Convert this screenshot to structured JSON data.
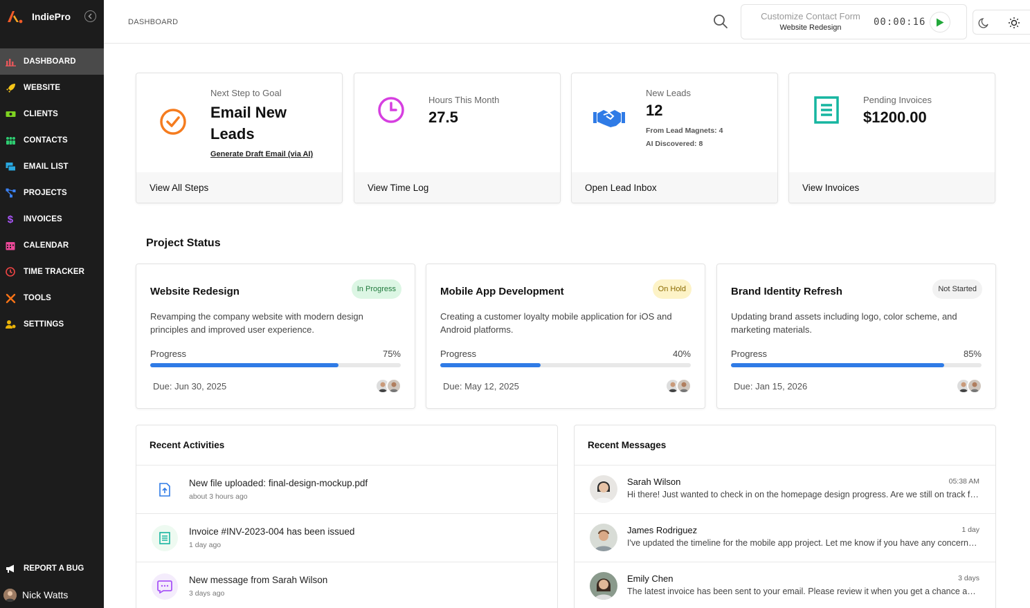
{
  "app": {
    "name": "IndiePro"
  },
  "sidebar": {
    "items": [
      {
        "label": "DASHBOARD",
        "icon": "bar-chart-icon",
        "color": "#e2575a",
        "active": true
      },
      {
        "label": "WEBSITE",
        "icon": "rocket-icon",
        "color": "#f5c518"
      },
      {
        "label": "CLIENTS",
        "icon": "cash-icon",
        "color": "#7ed321"
      },
      {
        "label": "CONTACTS",
        "icon": "people-icon",
        "color": "#2ecc71"
      },
      {
        "label": "EMAIL LIST",
        "icon": "email-list-icon",
        "color": "#29a8e0"
      },
      {
        "label": "PROJECTS",
        "icon": "project-tree-icon",
        "color": "#3b82f6"
      },
      {
        "label": "INVOICES",
        "icon": "dollar-icon",
        "color": "#a855f7"
      },
      {
        "label": "CALENDAR",
        "icon": "calendar-icon",
        "color": "#ec4899"
      },
      {
        "label": "TIME TRACKER",
        "icon": "clock-icon",
        "color": "#ef4444"
      },
      {
        "label": "TOOLS",
        "icon": "tools-icon",
        "color": "#f97316"
      },
      {
        "label": "SETTINGS",
        "icon": "user-settings-icon",
        "color": "#eab308"
      }
    ],
    "report_bug": "REPORT A BUG",
    "user_name": "Nick Watts"
  },
  "topbar": {
    "breadcrumb": "DASHBOARD",
    "timer": {
      "task": "Customize Contact Form",
      "project": "Website Redesign",
      "elapsed": "00:00:16"
    }
  },
  "stats": {
    "next_step": {
      "label": "Next Step to Goal",
      "value": "Email New Leads",
      "link": "Generate Draft Email (via AI)",
      "footer": "View All Steps",
      "color": "#f57c1f"
    },
    "hours": {
      "label": "Hours This Month",
      "value": "27.5",
      "footer": "View Time Log",
      "color": "#d63fe0"
    },
    "leads": {
      "label": "New Leads",
      "value": "12",
      "sub1": "From Lead Magnets: 4",
      "sub2": "AI Discovered: 8",
      "footer": "Open Lead Inbox",
      "color": "#2f7be6"
    },
    "invoices": {
      "label": "Pending Invoices",
      "value": "$1200.00",
      "footer": "View Invoices",
      "color": "#16b5a0"
    }
  },
  "project_status": {
    "title": "Project Status",
    "progress_label": "Progress",
    "projects": [
      {
        "name": "Website Redesign",
        "status": "In Progress",
        "status_bg": "#dcf6e4",
        "status_fg": "#1f7a3c",
        "desc": "Revamping the company website with modern design principles and improved user experience.",
        "progress": 75,
        "progress_text": "75%",
        "due": "Due: Jun 30, 2025"
      },
      {
        "name": "Mobile App Development",
        "status": "On Hold",
        "status_bg": "#fdf3c7",
        "status_fg": "#8a6a00",
        "desc": "Creating a customer loyalty mobile application for iOS and Android platforms.",
        "progress": 40,
        "progress_text": "40%",
        "due": "Due: May 12, 2025"
      },
      {
        "name": "Brand Identity Refresh",
        "status": "Not Started",
        "status_bg": "#f2f2f2",
        "status_fg": "#333333",
        "desc": "Updating brand assets including logo, color scheme, and marketing materials.",
        "progress": 85,
        "progress_text": "85%",
        "due": "Due: Jan 15, 2026"
      }
    ]
  },
  "activities": {
    "title": "Recent Activities",
    "items": [
      {
        "title": "New file uploaded: final-design-mockup.pdf",
        "time": "about 3 hours ago",
        "icon": "file-upload-icon"
      },
      {
        "title": "Invoice #INV-2023-004 has been issued",
        "time": "1 day ago",
        "icon": "invoice-icon"
      },
      {
        "title": "New message from Sarah Wilson",
        "time": "3 days ago",
        "icon": "message-icon"
      }
    ]
  },
  "messages": {
    "title": "Recent Messages",
    "items": [
      {
        "name": "Sarah Wilson",
        "time": "05:38 AM",
        "text": "Hi there! Just wanted to check in on the homepage design progress. Are we still on track for the Friday review?"
      },
      {
        "name": "James Rodriguez",
        "time": "1 day",
        "text": "I've updated the timeline for the mobile app project. Let me know if you have any concerns about the new dates."
      },
      {
        "name": "Emily Chen",
        "time": "3 days",
        "text": "The latest invoice has been sent to your email. Please review it when you get a chance and let me know."
      }
    ]
  }
}
